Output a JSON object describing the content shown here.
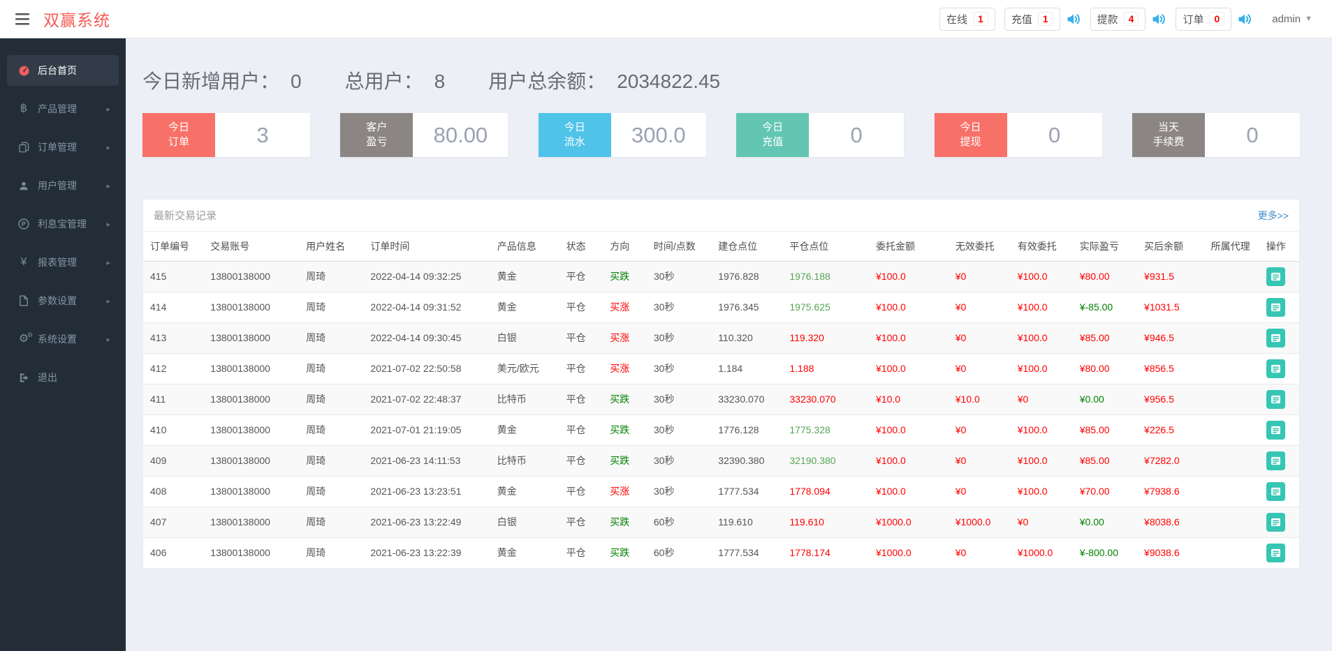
{
  "colors": {
    "logo_red": "#f55b55",
    "badge_count_red": "#ff0000",
    "speaker_blue": "#35b0e8",
    "sidebar_bg": "#232d38",
    "sidebar_active_bg": "#313c48",
    "card_red": "#f87168",
    "card_gray": "#8b8683",
    "card_sky": "#50c3e9",
    "card_teal": "#63c6b3",
    "link_blue": "#428bca",
    "op_button_teal": "#36c6b4",
    "up_red": "#ff0000",
    "down_green": "#008000",
    "close_green": "#55a555"
  },
  "topbar": {
    "logo": "双赢系统",
    "badges": [
      {
        "label": "在线",
        "count": "1",
        "speaker": false
      },
      {
        "label": "充值",
        "count": "1",
        "speaker": true
      },
      {
        "label": "提款",
        "count": "4",
        "speaker": true
      },
      {
        "label": "订单",
        "count": "0",
        "speaker": true
      }
    ],
    "user": "admin"
  },
  "sidebar": {
    "items": [
      {
        "label": "后台首页",
        "icon": "dashboard-icon",
        "active": true,
        "chevron": false
      },
      {
        "label": "产品管理",
        "icon": "bitcoin-icon",
        "active": false,
        "chevron": true
      },
      {
        "label": "订单管理",
        "icon": "orders-icon",
        "active": false,
        "chevron": true
      },
      {
        "label": "用户管理",
        "icon": "user-icon",
        "active": false,
        "chevron": true
      },
      {
        "label": "利息宝管理",
        "icon": "interest-icon",
        "active": false,
        "chevron": true
      },
      {
        "label": "报表管理",
        "icon": "yen-icon",
        "active": false,
        "chevron": true
      },
      {
        "label": "参数设置",
        "icon": "params-icon",
        "active": false,
        "chevron": true
      },
      {
        "label": "系统设置",
        "icon": "gears-icon",
        "active": false,
        "chevron": true
      },
      {
        "label": "退出",
        "icon": "logout-icon",
        "active": false,
        "chevron": false
      }
    ]
  },
  "summary": {
    "items": [
      {
        "label": "今日新增用户：",
        "value": "0"
      },
      {
        "label": "总用户：",
        "value": "8"
      },
      {
        "label": "用户总余额：",
        "value": "2034822.45"
      }
    ]
  },
  "cards": [
    {
      "line1": "今日",
      "line2": "订单",
      "value": "3",
      "color": "#f87168"
    },
    {
      "line1": "客户",
      "line2": "盈亏",
      "value": "80.00",
      "color": "#8b8683"
    },
    {
      "line1": "今日",
      "line2": "流水",
      "value": "300.0",
      "color": "#50c3e9"
    },
    {
      "line1": "今日",
      "line2": "充值",
      "value": "0",
      "color": "#63c6b3"
    },
    {
      "line1": "今日",
      "line2": "提现",
      "value": "0",
      "color": "#f87168"
    },
    {
      "line1": "当天",
      "line2": "手续费",
      "value": "0",
      "color": "#8b8683"
    }
  ],
  "table": {
    "title": "最新交易记录",
    "more_link": "更多>>",
    "headers": [
      "订单编号",
      "交易账号",
      "用户姓名",
      "订单时间",
      "产品信息",
      "状态",
      "方向",
      "时间/点数",
      "建仓点位",
      "平仓点位",
      "委托金额",
      "无效委托",
      "有效委托",
      "实际盈亏",
      "买后余额",
      "所属代理",
      "操作"
    ],
    "rows": [
      {
        "id": "415",
        "account": "13800138000",
        "name": "周琦",
        "time": "2022-04-14 09:32:25",
        "product": "黄金",
        "status": "平仓",
        "direction": "买跌",
        "direction_color": "green",
        "duration": "30秒",
        "open": "1976.828",
        "close": "1976.188",
        "close_color": "green",
        "amount": "¥100.0",
        "invalid": "¥0",
        "valid": "¥100.0",
        "profit": "¥80.00",
        "profit_color": "red",
        "balance": "¥931.5",
        "agent": ""
      },
      {
        "id": "414",
        "account": "13800138000",
        "name": "周琦",
        "time": "2022-04-14 09:31:52",
        "product": "黄金",
        "status": "平仓",
        "direction": "买涨",
        "direction_color": "red",
        "duration": "30秒",
        "open": "1976.345",
        "close": "1975.625",
        "close_color": "green",
        "amount": "¥100.0",
        "invalid": "¥0",
        "valid": "¥100.0",
        "profit": "¥-85.00",
        "profit_color": "green",
        "balance": "¥1031.5",
        "agent": ""
      },
      {
        "id": "413",
        "account": "13800138000",
        "name": "周琦",
        "time": "2022-04-14 09:30:45",
        "product": "白银",
        "status": "平仓",
        "direction": "买涨",
        "direction_color": "red",
        "duration": "30秒",
        "open": "110.320",
        "close": "119.320",
        "close_color": "red",
        "amount": "¥100.0",
        "invalid": "¥0",
        "valid": "¥100.0",
        "profit": "¥85.00",
        "profit_color": "red",
        "balance": "¥946.5",
        "agent": ""
      },
      {
        "id": "412",
        "account": "13800138000",
        "name": "周琦",
        "time": "2021-07-02 22:50:58",
        "product": "美元/欧元",
        "status": "平仓",
        "direction": "买涨",
        "direction_color": "red",
        "duration": "30秒",
        "open": "1.184",
        "close": "1.188",
        "close_color": "red",
        "amount": "¥100.0",
        "invalid": "¥0",
        "valid": "¥100.0",
        "profit": "¥80.00",
        "profit_color": "red",
        "balance": "¥856.5",
        "agent": ""
      },
      {
        "id": "411",
        "account": "13800138000",
        "name": "周琦",
        "time": "2021-07-02 22:48:37",
        "product": "比特币",
        "status": "平仓",
        "direction": "买跌",
        "direction_color": "green",
        "duration": "30秒",
        "open": "33230.070",
        "close": "33230.070",
        "close_color": "red",
        "amount": "¥10.0",
        "invalid": "¥10.0",
        "valid": "¥0",
        "profit": "¥0.00",
        "profit_color": "green",
        "balance": "¥956.5",
        "agent": ""
      },
      {
        "id": "410",
        "account": "13800138000",
        "name": "周琦",
        "time": "2021-07-01 21:19:05",
        "product": "黄金",
        "status": "平仓",
        "direction": "买跌",
        "direction_color": "green",
        "duration": "30秒",
        "open": "1776.128",
        "close": "1775.328",
        "close_color": "green",
        "amount": "¥100.0",
        "invalid": "¥0",
        "valid": "¥100.0",
        "profit": "¥85.00",
        "profit_color": "red",
        "balance": "¥226.5",
        "agent": ""
      },
      {
        "id": "409",
        "account": "13800138000",
        "name": "周琦",
        "time": "2021-06-23 14:11:53",
        "product": "比特币",
        "status": "平仓",
        "direction": "买跌",
        "direction_color": "green",
        "duration": "30秒",
        "open": "32390.380",
        "close": "32190.380",
        "close_color": "green",
        "amount": "¥100.0",
        "invalid": "¥0",
        "valid": "¥100.0",
        "profit": "¥85.00",
        "profit_color": "red",
        "balance": "¥7282.0",
        "agent": ""
      },
      {
        "id": "408",
        "account": "13800138000",
        "name": "周琦",
        "time": "2021-06-23 13:23:51",
        "product": "黄金",
        "status": "平仓",
        "direction": "买涨",
        "direction_color": "red",
        "duration": "30秒",
        "open": "1777.534",
        "close": "1778.094",
        "close_color": "red",
        "amount": "¥100.0",
        "invalid": "¥0",
        "valid": "¥100.0",
        "profit": "¥70.00",
        "profit_color": "red",
        "balance": "¥7938.6",
        "agent": ""
      },
      {
        "id": "407",
        "account": "13800138000",
        "name": "周琦",
        "time": "2021-06-23 13:22:49",
        "product": "白银",
        "status": "平仓",
        "direction": "买跌",
        "direction_color": "green",
        "duration": "60秒",
        "open": "119.610",
        "close": "119.610",
        "close_color": "red",
        "amount": "¥1000.0",
        "invalid": "¥1000.0",
        "valid": "¥0",
        "profit": "¥0.00",
        "profit_color": "green",
        "balance": "¥8038.6",
        "agent": ""
      },
      {
        "id": "406",
        "account": "13800138000",
        "name": "周琦",
        "time": "2021-06-23 13:22:39",
        "product": "黄金",
        "status": "平仓",
        "direction": "买跌",
        "direction_color": "green",
        "duration": "60秒",
        "open": "1777.534",
        "close": "1778.174",
        "close_color": "red",
        "amount": "¥1000.0",
        "invalid": "¥0",
        "valid": "¥1000.0",
        "profit": "¥-800.00",
        "profit_color": "green",
        "balance": "¥9038.6",
        "agent": ""
      }
    ]
  }
}
